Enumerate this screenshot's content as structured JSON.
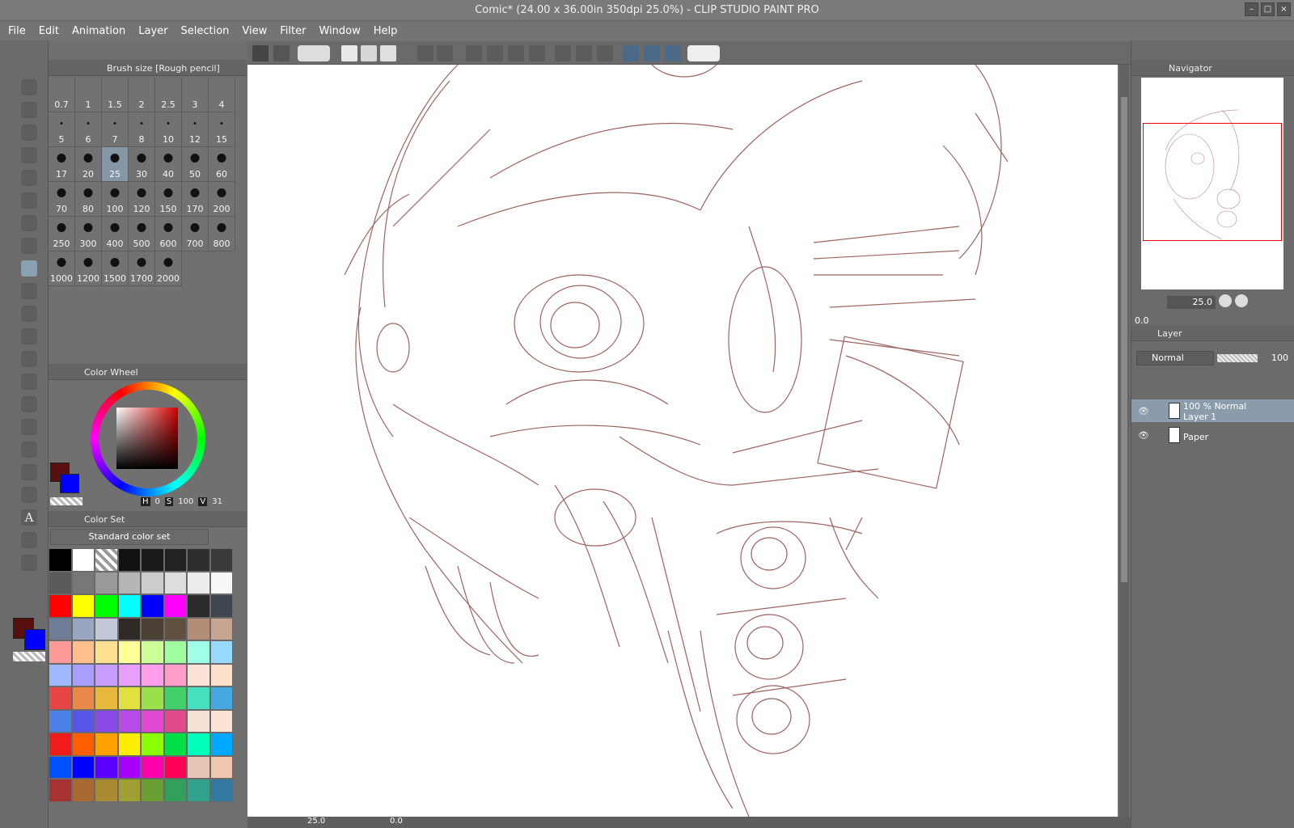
{
  "window": {
    "title": "Comic* (24.00 x 36.00in 350dpi 25.0%)  - CLIP STUDIO PAINT PRO"
  },
  "menu": [
    "File",
    "Edit",
    "Animation",
    "Layer",
    "Selection",
    "View",
    "Filter",
    "Window",
    "Help"
  ],
  "brush_panel": {
    "title": "Brush size [Rough pencil]",
    "sizes": [
      "0.7",
      "1",
      "1.5",
      "2",
      "2.5",
      "3",
      "4",
      "5",
      "6",
      "7",
      "8",
      "10",
      "12",
      "15",
      "17",
      "20",
      "25",
      "30",
      "40",
      "50",
      "60",
      "70",
      "80",
      "100",
      "120",
      "150",
      "170",
      "200",
      "250",
      "300",
      "400",
      "500",
      "600",
      "700",
      "800",
      "1000",
      "1200",
      "1500",
      "1700",
      "2000"
    ],
    "selected": "25"
  },
  "color_wheel": {
    "title": "Color Wheel",
    "h_label": "H",
    "h_value": "0",
    "s_label": "S",
    "s_value": "100",
    "v_label": "V",
    "v_value": "31",
    "main_color": "#5a0f0f",
    "sub_color": "#0000ff"
  },
  "color_set": {
    "title": "Color Set",
    "set_name": "Standard color set",
    "swatches": [
      "#000000",
      "#ffffff",
      "checker",
      "#111111",
      "#1a1a1a",
      "#222222",
      "#2e2e2e",
      "#3a3a3a",
      "#5a5a5a",
      "#777777",
      "#999999",
      "#b5b5b5",
      "#cccccc",
      "#dddddd",
      "#ececec",
      "#f7f7f7",
      "#ff0000",
      "#ffff00",
      "#00ff00",
      "#00ffff",
      "#0000ff",
      "#ff00ff",
      "#2a2a2a",
      "#3f4652",
      "#6f7c95",
      "#9aa6c0",
      "#c3c8d8",
      "#2f2a24",
      "#4a4034",
      "#5f5040",
      "#b38d78",
      "#c8a592",
      "#ff9a9a",
      "#ffbf8f",
      "#ffdf90",
      "#ffff98",
      "#ccff98",
      "#9fff9f",
      "#9fffe6",
      "#99d8ff",
      "#9fb8ff",
      "#a89fff",
      "#c89fff",
      "#e69fff",
      "#ff9fec",
      "#ff9fc8",
      "#fbe3d8",
      "#fde0cc",
      "#e84545",
      "#e8894a",
      "#e8b93c",
      "#e0e040",
      "#9ae04a",
      "#44d069",
      "#45e0c0",
      "#45a8e0",
      "#4a80e8",
      "#5656e8",
      "#8a4ae8",
      "#b84ae8",
      "#e04ad0",
      "#e04a8a",
      "#f5e0d4",
      "#fbe4d3",
      "#f01c1c",
      "#ff5f00",
      "#ffa100",
      "#ffee00",
      "#8aff00",
      "#00e046",
      "#00ffbb",
      "#00a8ff",
      "#0050ff",
      "#0000ff",
      "#5a00ff",
      "#a800ff",
      "#ff00aa",
      "#ff0055",
      "#e8c4b4",
      "#f0c8b0",
      "#a83232",
      "#a86a32",
      "#a88a32",
      "#a0a032",
      "#6aa032",
      "#32a05a",
      "#32a08a",
      "#3278a0"
    ]
  },
  "canvas": {
    "zoom": "25.0",
    "rotation": "0.0"
  },
  "navigator": {
    "title": "Navigator",
    "zoom": "25.0",
    "rotation": "0.0"
  },
  "layer_panel": {
    "title": "Layer",
    "blend_mode": "Normal",
    "opacity": "100",
    "layers": [
      {
        "meta": "100 % Normal",
        "name": "Layer 1",
        "selected": true
      },
      {
        "meta": "",
        "name": "Paper",
        "selected": false
      }
    ]
  },
  "colors": {
    "sketch_stroke": "#8b4a46",
    "selected_highlight": "#8a9bab"
  }
}
